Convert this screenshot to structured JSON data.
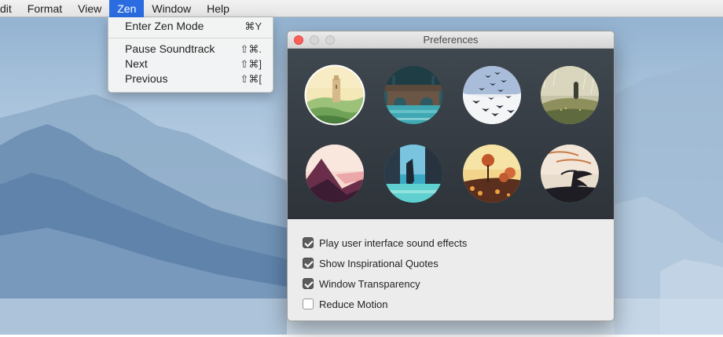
{
  "menubar": {
    "items": [
      {
        "label": "dit",
        "active": false
      },
      {
        "label": "Format",
        "active": false
      },
      {
        "label": "View",
        "active": false
      },
      {
        "label": "Zen",
        "active": true
      },
      {
        "label": "Window",
        "active": false
      },
      {
        "label": "Help",
        "active": false
      }
    ]
  },
  "zen_menu": {
    "items": [
      {
        "label": "Enter Zen Mode",
        "shortcut": "⌘Y"
      },
      {
        "label": "Pause Soundtrack",
        "shortcut": "⇧⌘."
      },
      {
        "label": "Next",
        "shortcut": "⇧⌘]"
      },
      {
        "label": "Previous",
        "shortcut": "⇧⌘["
      }
    ]
  },
  "preferences": {
    "title": "Preferences",
    "themes": [
      {
        "icon": "tower-hills-icon",
        "selected": true
      },
      {
        "icon": "stone-bridge-icon",
        "selected": false
      },
      {
        "icon": "bird-flock-icon",
        "selected": false
      },
      {
        "icon": "rainy-hill-figure-icon",
        "selected": false
      },
      {
        "icon": "pink-mountain-icon",
        "selected": false
      },
      {
        "icon": "waterfall-cliff-icon",
        "selected": false
      },
      {
        "icon": "autumn-tree-icon",
        "selected": false
      },
      {
        "icon": "windswept-tree-icon",
        "selected": false
      }
    ],
    "options": [
      {
        "label": "Play user interface sound effects",
        "checked": true
      },
      {
        "label": "Show Inspirational Quotes",
        "checked": true
      },
      {
        "label": "Window Transparency",
        "checked": true
      },
      {
        "label": "Reduce Motion",
        "checked": false
      }
    ]
  },
  "colors": {
    "menu_highlight": "#2b6ce0",
    "close_button": "#fc5f57",
    "checkbox_checked": "#5b5b5b"
  }
}
